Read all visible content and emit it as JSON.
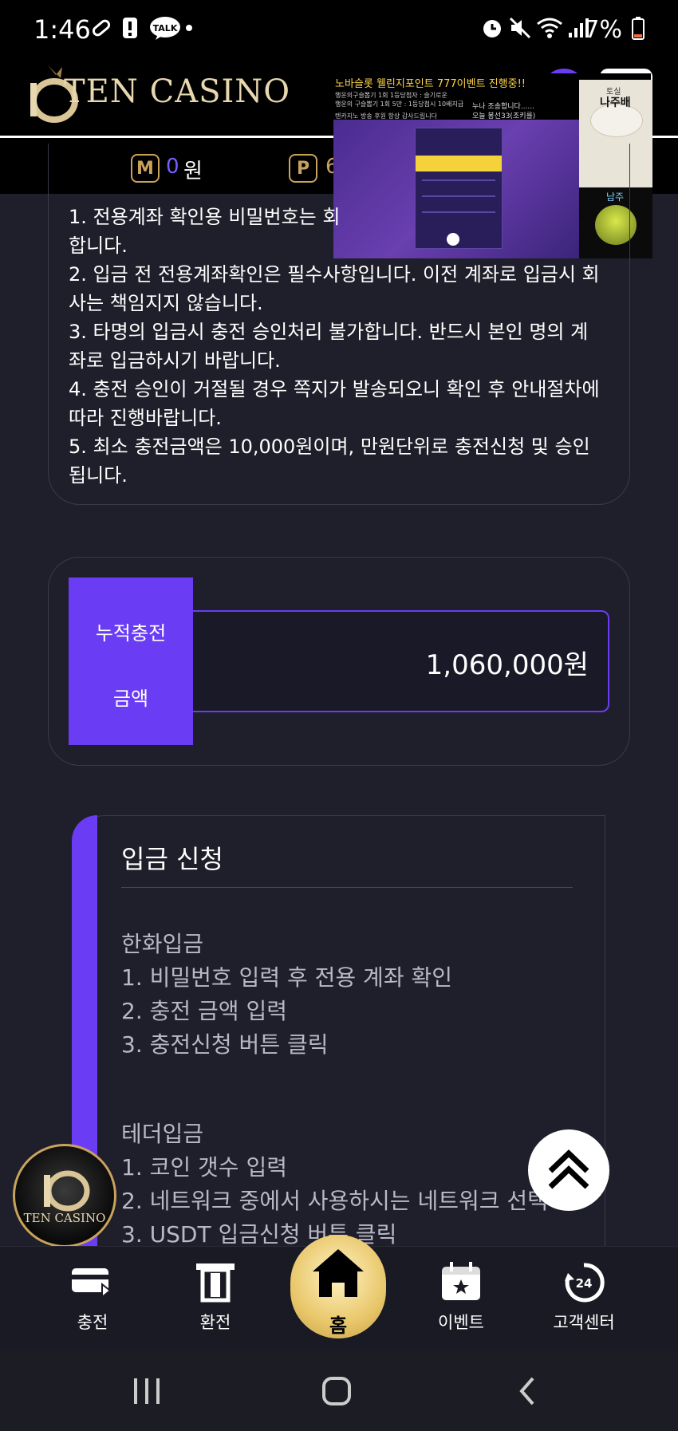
{
  "status_bar": {
    "time": "1:46",
    "battery": "7%",
    "talk_icon_text": "TALK"
  },
  "header": {
    "brand": "TEN CASINO"
  },
  "balance": {
    "m_badge": "M",
    "m_value": "0",
    "m_unit": "원",
    "p_badge": "P",
    "p_value": "6"
  },
  "overlay": {
    "title": "노바슬롯 웰린지포인트 777이벤트 진행중!!",
    "line1": "행운의구슬뽑기 1회 1등당첨자 : 슬기로운",
    "line2": "행운의 구슬뽑기 1회 5만 : 1등당첨시 10배지급",
    "line3": "텐카지노 방송 후원 항상 감사드립니다",
    "chat1": "누나 조송합니다......",
    "chat2": "오늘 봉선33(조키를)",
    "side_title": "토실",
    "side_subtitle": "나주배",
    "side_bottom": "남주"
  },
  "notice": {
    "lines": [
      "1. 전용계좌 확인용 비밀번호는 회",
      "합니다.",
      "2. 입금 전 전용계좌확인은 필수사항입니다. 이전 계좌로 입금시 회",
      "사는 책임지지 않습니다.",
      "3. 타명의 입금시 충전 승인처리 불가합니다. 반드시 본인 명의 계",
      "좌로 입금하시기 바랍니다.",
      "4. 충전 승인이 거절될 경우 쪽지가 발송되오니 확인 후 안내절차에",
      "따라 진행바랍니다.",
      "5. 최소 충전금액은 10,000원이며, 만원단위로 충전신청 및 승인",
      "됩니다."
    ]
  },
  "accumulated": {
    "label_line1": "누적충전",
    "label_line2": "금액",
    "value": "1,060,000원"
  },
  "deposit": {
    "title": "입금 신청",
    "lines": [
      "한화입금",
      "1. 비밀번호 입력 후 전용 계좌 확인",
      "2. 충전 금액 입력",
      "3. 충전신청 버튼 클릭",
      "",
      "테더입금",
      "1. 코인 갯수 입력",
      "2. 네트워크 중에서 사용하시는 네트워크 선택",
      "3. USDT 입금신청 버튼 클릭"
    ]
  },
  "floating_logo": {
    "text": "TEN CASINO"
  },
  "bottom_nav": {
    "items": [
      {
        "label": "충전",
        "icon": "card-icon"
      },
      {
        "label": "환전",
        "icon": "atm-icon"
      },
      {
        "label": "홈",
        "icon": "home-icon"
      },
      {
        "label": "이벤트",
        "icon": "calendar-star-icon"
      },
      {
        "label": "고객센터",
        "icon": "support-24-icon"
      }
    ]
  },
  "colors": {
    "accent": "#6a3df5",
    "gold": "#c9a35a",
    "background": "#1f1f2b"
  }
}
